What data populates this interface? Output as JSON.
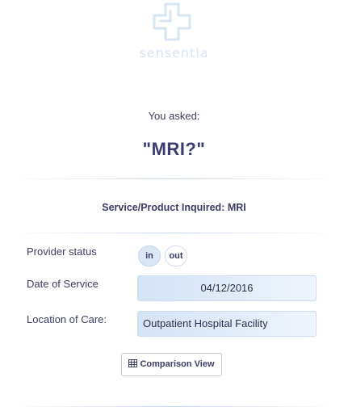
{
  "brand": {
    "name": "sensentia",
    "logo_icon": "medical-cross-icon"
  },
  "inquiry": {
    "asked_label": "You asked:",
    "query_text": "\"MRI?\""
  },
  "service": {
    "line": "Service/Product Inquired: MRI"
  },
  "form": {
    "provider_status": {
      "label": "Provider status",
      "options": [
        "in",
        "out"
      ],
      "selected": "in"
    },
    "date_of_service": {
      "label": "Date of Service",
      "value": "04/12/2016"
    },
    "location_of_care": {
      "label": "Location of Care:",
      "value": "Outpatient Hospital Facility"
    }
  },
  "actions": {
    "comparison_view": {
      "label": "Comparison View",
      "icon": "table-icon"
    }
  },
  "colors": {
    "text": "#3c3c66",
    "logo": "#d7e4f3",
    "field_bg": "#d4e3f6",
    "toggle_active": "#dbe6f6"
  }
}
